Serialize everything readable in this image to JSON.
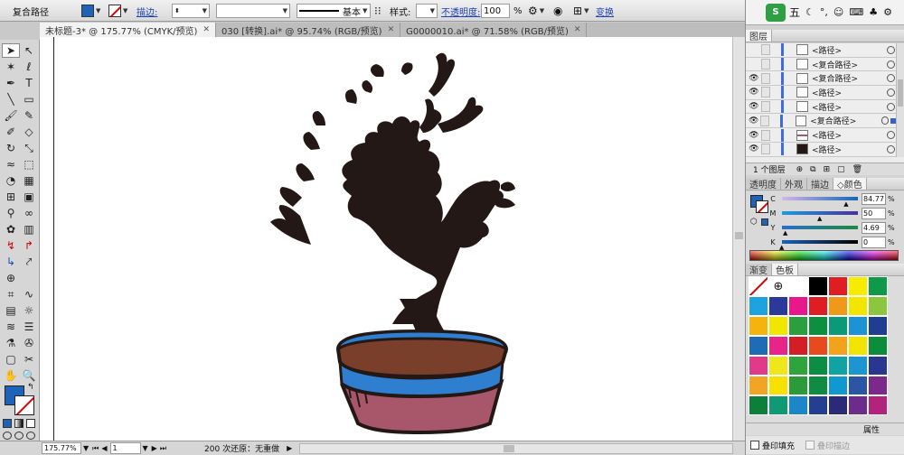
{
  "control": {
    "object_label": "复合路径",
    "fill_color": "#1e63b8",
    "stroke_label": "描边:",
    "stroke_profile": "基本",
    "style_label": "样式:",
    "opacity_label": "不透明度:",
    "opacity_value": "100",
    "opacity_unit": "%",
    "transform_label": "变换"
  },
  "tabs": [
    {
      "label": "未标题-3* @ 175.77% (CMYK/预览)",
      "active": true
    },
    {
      "label": "030 [转换].ai* @ 95.74% (RGB/预览)",
      "active": false
    },
    {
      "label": "G0000010.ai* @ 71.58% (RGB/预览)",
      "active": false
    }
  ],
  "tools": [
    "selection-tool",
    "direct-select-tool",
    "magic-wand-tool",
    "lasso-tool",
    "pen-tool",
    "type-tool",
    "line-tool",
    "rectangle-tool",
    "paintbrush-tool",
    "pencil-tool",
    "blob-brush-tool",
    "eraser-tool",
    "rotate-tool",
    "scale-tool",
    "warp-tool",
    "free-transform-tool",
    "shape-builder-tool",
    "perspective-tool",
    "mesh-tool",
    "gradient-tool",
    "eyedropper-tool",
    "blend-tool",
    "symbol-sprayer-tool",
    "column-graph-tool",
    "artboard-tool",
    "slice-tool",
    "hand-tool",
    "zoom-tool"
  ],
  "status": {
    "zoom": "175.77%",
    "page": "1",
    "info": "200 次还原：无重做"
  },
  "system_tray": {
    "ime": "五"
  },
  "layers": {
    "title": "图层",
    "rows": [
      {
        "name": "<路径>",
        "visible": false
      },
      {
        "name": "<复合路径>",
        "visible": false
      },
      {
        "name": "<复合路径>",
        "visible": true
      },
      {
        "name": "<路径>",
        "visible": true
      },
      {
        "name": "<路径>",
        "visible": true
      },
      {
        "name": "<复合路径>",
        "visible": true,
        "selected": true
      },
      {
        "name": "<路径>",
        "visible": true
      },
      {
        "name": "<路径>",
        "visible": true
      }
    ],
    "footer": "1 个图层"
  },
  "color_panel": {
    "tabs": [
      {
        "label": "透明度",
        "active": false
      },
      {
        "label": "外观",
        "active": false
      },
      {
        "label": "描边",
        "active": false
      },
      {
        "label": "◇颜色",
        "active": true
      }
    ],
    "channels": [
      {
        "label": "C",
        "value": "84.77",
        "fraction": 0.8477
      },
      {
        "label": "M",
        "value": "50",
        "fraction": 0.5
      },
      {
        "label": "Y",
        "value": "4.69",
        "fraction": 0.0469
      },
      {
        "label": "K",
        "value": "0",
        "fraction": 0
      }
    ],
    "percent": "%"
  },
  "swatches": {
    "tabs": [
      {
        "label": "渐变",
        "active": false
      },
      {
        "label": "色板",
        "active": true
      }
    ],
    "colors": [
      "none",
      "registration",
      "#ffffff",
      "#000000",
      "#e11d24",
      "#f5ec00",
      "#0e9a48",
      "#1fa3e0",
      "#2b3a9a",
      "#e8178b",
      "#e01c24",
      "#f09819",
      "#f2e600",
      "#8cc63f",
      "#f7b30d",
      "#f0e600",
      "#2b9f3e",
      "#0c8f3f",
      "#0a9a78",
      "#1d93d6",
      "#1f3e93",
      "#1f6cb6",
      "#e8238a",
      "#d31e25",
      "#e8491d",
      "#f2a21b",
      "#f1e500",
      "#0b8d3c",
      "#e23a8a",
      "#f0e61c",
      "#2fa43c",
      "#0b8e44",
      "#11a2a4",
      "#1b96d3",
      "#2a3790",
      "#f2a524",
      "#f7e100",
      "#2b9b3a",
      "#0f8c41",
      "#1098d0",
      "#2a56a5",
      "#7b2a8c",
      "#0c7f3b",
      "#0f9a73",
      "#1b87c9",
      "#243f92",
      "#2a2a78",
      "#6c2c8c",
      "#b3237e"
    ],
    "overprint_fill": "叠印填充",
    "overprint_stroke": "叠印描边",
    "bottom_label": "属性"
  }
}
